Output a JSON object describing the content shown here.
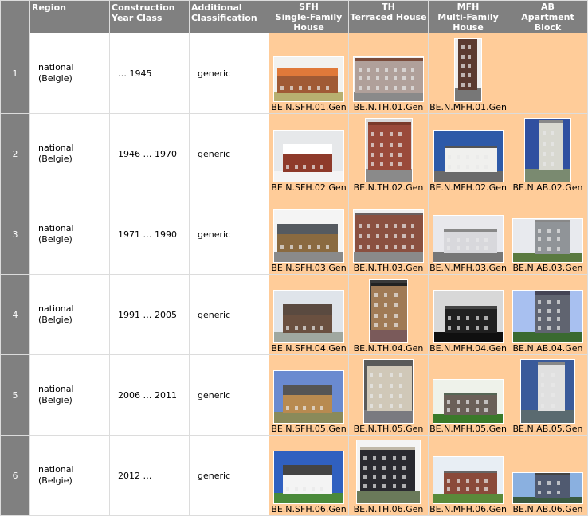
{
  "header": {
    "index_label": "",
    "region": "Region",
    "construction_year_class": "Construction Year Class",
    "additional_classification": "Additional Classification",
    "types": [
      {
        "code": "SFH",
        "name": "Single-Family House"
      },
      {
        "code": "TH",
        "name": "Terraced House"
      },
      {
        "code": "MFH",
        "name": "Multi-Family House"
      },
      {
        "code": "AB",
        "name": "Apartment Block"
      }
    ]
  },
  "colors": {
    "header_bg": "#808080",
    "image_cell_bg": "#ffcc99",
    "grid": "#dcdcdc"
  },
  "rows": [
    {
      "index": "1",
      "region_line1": "national",
      "region_line2": "(Belgie)",
      "year_class": "… 1945",
      "additional": "generic",
      "images": [
        {
          "label": "BE.N.SFH.01.Gen",
          "photo": "brick-farmhouse-orange-roof"
        },
        {
          "label": "BE.N.TH.01.Gen",
          "photo": "terraced-townhouses-row"
        },
        {
          "label": "BE.N.MFH.01.Gen",
          "photo": "narrow-multistorey-apartment"
        },
        {
          "label": "",
          "photo": ""
        }
      ]
    },
    {
      "index": "2",
      "region_line1": "national",
      "region_line2": "(Belgie)",
      "year_class": "1946 … 1970",
      "additional": "generic",
      "images": [
        {
          "label": "BE.N.SFH.02.Gen",
          "photo": "brick-house-snow"
        },
        {
          "label": "BE.N.TH.02.Gen",
          "photo": "brick-terraced-house"
        },
        {
          "label": "BE.N.MFH.02.Gen",
          "photo": "white-balcony-apartments"
        },
        {
          "label": "BE.N.AB.02.Gen",
          "photo": "tall-apartment-block"
        }
      ]
    },
    {
      "index": "3",
      "region_line1": "national",
      "region_line2": "(Belgie)",
      "year_class": "1971 … 1990",
      "additional": "generic",
      "images": [
        {
          "label": "BE.N.SFH.03.Gen",
          "photo": "bungalow-paved-driveway"
        },
        {
          "label": "BE.N.TH.03.Gen",
          "photo": "brick-terraced-garages"
        },
        {
          "label": "BE.N.MFH.03.Gen",
          "photo": "urban-apartment-building"
        },
        {
          "label": "BE.N.AB.03.Gen",
          "photo": "high-rise-tower-block"
        }
      ]
    },
    {
      "index": "4",
      "region_line1": "national",
      "region_line2": "(Belgie)",
      "year_class": "1991 … 2005",
      "additional": "generic",
      "images": [
        {
          "label": "BE.N.SFH.04.Gen",
          "photo": "thatched-villa"
        },
        {
          "label": "BE.N.TH.04.Gen",
          "photo": "brick-townhouse-arched-window"
        },
        {
          "label": "BE.N.MFH.04.Gen",
          "photo": "monochrome-apartments-trees"
        },
        {
          "label": "BE.N.AB.04.Gen",
          "photo": "twin-high-rise-towers"
        }
      ]
    },
    {
      "index": "5",
      "region_line1": "national",
      "region_line2": "(Belgie)",
      "year_class": "2006 … 2011",
      "additional": "generic",
      "images": [
        {
          "label": "BE.N.SFH.05.Gen",
          "photo": "yellow-brick-detached-house"
        },
        {
          "label": "BE.N.TH.05.Gen",
          "photo": "modern-terraced-house-garage"
        },
        {
          "label": "BE.N.MFH.05.Gen",
          "photo": "terraced-apartments-hedge"
        },
        {
          "label": "BE.N.AB.05.Gen",
          "photo": "waterfront-apartment-tower"
        }
      ]
    },
    {
      "index": "6",
      "region_line1": "national",
      "region_line2": "(Belgie)",
      "year_class": "2012 …",
      "additional": "generic",
      "images": [
        {
          "label": "BE.N.SFH.06.Gen",
          "photo": "white-cottage-villa"
        },
        {
          "label": "BE.N.TH.06.Gen",
          "photo": "dark-modern-townhouse"
        },
        {
          "label": "BE.N.MFH.06.Gen",
          "photo": "brick-apartment-complex"
        },
        {
          "label": "BE.N.AB.06.Gen",
          "photo": "office-apartment-towers"
        }
      ]
    }
  ]
}
